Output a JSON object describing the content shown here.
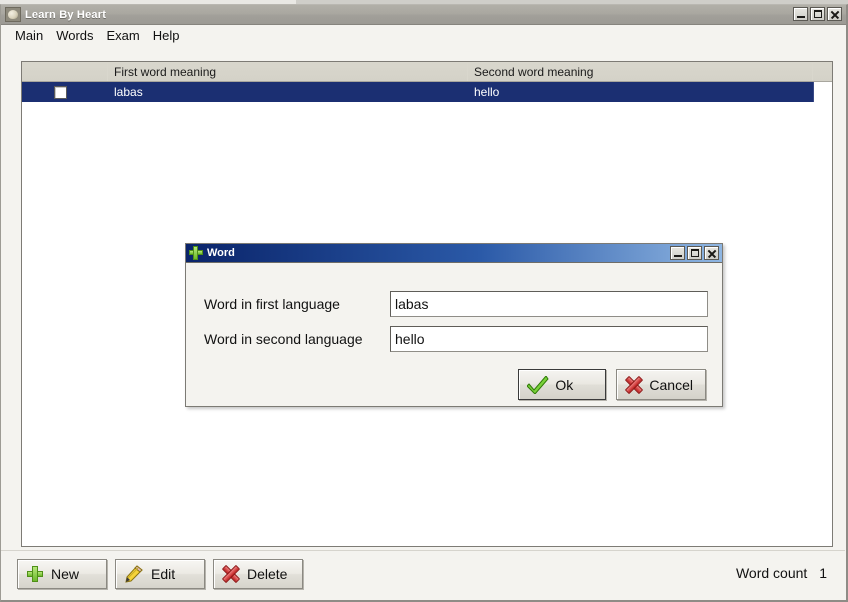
{
  "app": {
    "title": "Learn By Heart",
    "icon": "paw-icon",
    "window_controls": [
      {
        "name": "minimize",
        "glyph": "_"
      },
      {
        "name": "maximize",
        "glyph": "□"
      },
      {
        "name": "close",
        "glyph": "×"
      }
    ]
  },
  "menubar": {
    "items": [
      {
        "label": "Main"
      },
      {
        "label": "Words"
      },
      {
        "label": "Exam"
      },
      {
        "label": "Help"
      }
    ]
  },
  "grid": {
    "columns": [
      {
        "key": "check",
        "label": ""
      },
      {
        "key": "first",
        "label": "First word meaning"
      },
      {
        "key": "second",
        "label": "Second word meaning"
      }
    ],
    "rows": [
      {
        "checked": false,
        "first": "labas",
        "second": "hello",
        "selected": true
      }
    ]
  },
  "toolbar": {
    "new_label": "New",
    "edit_label": "Edit",
    "delete_label": "Delete",
    "word_count_label": "Word count",
    "word_count_value": "1"
  },
  "dialog": {
    "title": "Word",
    "icon": "green-plus-icon",
    "window_controls": [
      {
        "name": "minimize",
        "glyph": "_"
      },
      {
        "name": "maximize",
        "glyph": "□"
      },
      {
        "name": "close",
        "glyph": "×"
      }
    ],
    "fields": [
      {
        "label": "Word in first language",
        "value": "labas",
        "placeholder": ""
      },
      {
        "label": "Word in second language",
        "value": "hello",
        "placeholder": ""
      }
    ],
    "ok_label": "Ok",
    "cancel_label": "Cancel"
  },
  "colors": {
    "selection_blue": "#1b2f72",
    "dialog_title_blue": "#0a246a",
    "accent_green": "#6cb92b",
    "accent_red": "#c02020",
    "window_chrome": "#a9a7a0"
  }
}
